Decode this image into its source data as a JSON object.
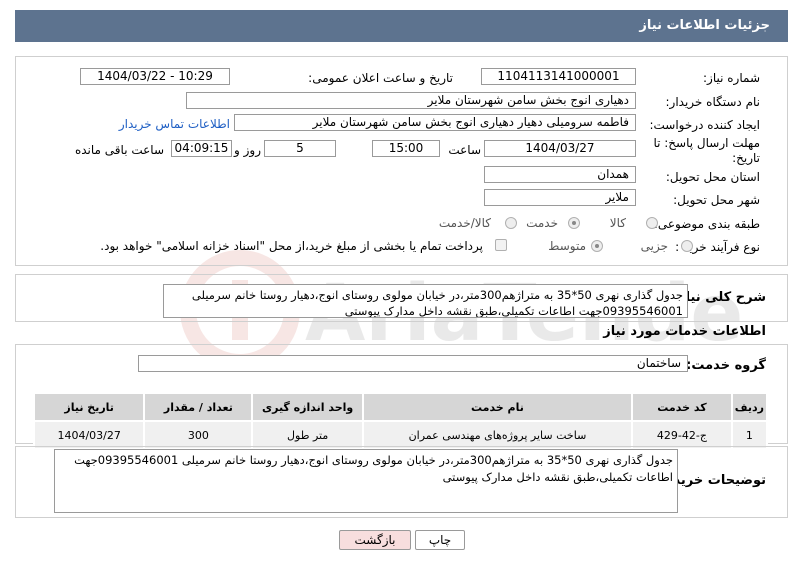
{
  "header": {
    "title": "جزئیات اطلاعات نیاز"
  },
  "form": {
    "need_number_label": "شماره نیاز:",
    "need_number": "1104113141000001",
    "announce_label": "تاریخ و ساعت اعلان عمومی:",
    "announce_value": "1404/03/22 - 10:29",
    "buyer_org_label": "نام دستگاه خریدار:",
    "buyer_org": "دهیاری انوج بخش سامن شهرستان ملایر",
    "creator_label": "ایجاد کننده درخواست:",
    "creator": "فاطمه سرومیلی دهیار دهیاری انوج بخش سامن شهرستان ملایر",
    "contact_link": "اطلاعات تماس خریدار",
    "deadline_label_1": "مهلت ارسال پاسخ: تا",
    "deadline_label_2": "تاریخ:",
    "deadline_date": "1404/03/27",
    "time_label": "ساعت",
    "deadline_time": "15:00",
    "days_value": "5",
    "days_label": "روز و",
    "remaining_time": "04:09:15",
    "remaining_label": "ساعت باقی مانده",
    "province_label": "استان محل تحویل:",
    "province": "همدان",
    "city_label": "شهر محل تحویل:",
    "city": "ملایر",
    "category_label": "طبقه بندی موضوعی:",
    "category_options": [
      "کالا",
      "خدمت",
      "کالا/خدمت"
    ],
    "process_label": "نوع فرآیند خرید :",
    "process_options": [
      "جزیی",
      "متوسط"
    ],
    "payment_note": "پرداخت تمام یا بخشی از مبلغ خرید،از محل \"اسناد خزانه اسلامی\" خواهد بود."
  },
  "summary": {
    "label": "شرح کلی نیاز:",
    "text": "جدول گذاری نهری 50*35 به متراژهم300متر،در خیابان مولوی روستای انوج،دهیار روستا خانم سرمیلی 09395546001جهت اطاعات تکمیلی،طبق نقشه داخل مدارک پیوستی"
  },
  "services": {
    "section_title": "اطلاعات خدمات مورد نیاز",
    "group_label": "گروه خدمت:",
    "group_value": "ساختمان",
    "columns": [
      "ردیف",
      "کد خدمت",
      "نام خدمت",
      "واحد اندازه گیری",
      "تعداد / مقدار",
      "تاریخ نیاز"
    ],
    "rows": [
      [
        "1",
        "ج-42-429",
        "ساخت سایر پروژه‌های مهندسی عمران",
        "متر طول",
        "300",
        "1404/03/27"
      ]
    ]
  },
  "buyer_notes": {
    "label": "توضیحات خریدار:",
    "text": "جدول گذاری نهری 50*35 به متراژهم300متر،در خیابان مولوی روستای انوج،دهیار روستا خانم سرمیلی 09395546001جهت اطاعات تکمیلی،طبق نقشه داخل مدارک پیوستی"
  },
  "buttons": {
    "print": "چاپ",
    "back": "بازگشت"
  },
  "watermark_text": "AriaTender.neT",
  "colors": {
    "header_bg": "#5d738f",
    "link": "#1f5fc4",
    "back_button_bg": "#f8dede",
    "watermark": "#c0392b"
  }
}
